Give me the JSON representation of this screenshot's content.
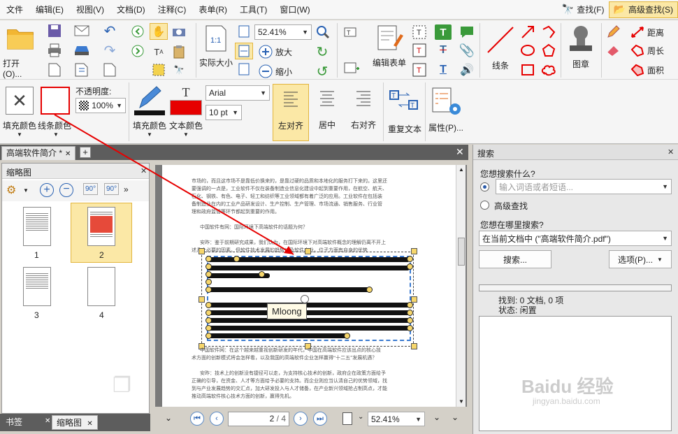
{
  "menu": [
    "文件",
    "编辑(E)",
    "视图(V)",
    "文档(D)",
    "注释(C)",
    "表单(R)",
    "工具(T)",
    "窗口(W)"
  ],
  "search_find": "查找(F)",
  "advanced_find": "高级查找(S)",
  "toolbar": {
    "open": "打开(O)...",
    "zoom_value": "52.41%",
    "actual_size": "实际大小",
    "zoom_in": "放大",
    "zoom_out": "缩小",
    "edit_form": "编辑表单",
    "line": "线条",
    "stamp": "图章",
    "distance": "距离",
    "perimeter": "周长",
    "area": "面积"
  },
  "props": {
    "fill_color": "填充颜色",
    "line_color": "线条颜色",
    "opacity_label": "不透明度:",
    "opacity_value": "100%",
    "fill_color2": "填充颜色",
    "text_color": "文本颜色",
    "font": "Arial",
    "font_size": "10 pt",
    "align_left": "左对齐",
    "align_center": "居中",
    "align_right": "右对齐",
    "repeat_text": "重复文本",
    "properties": "属性(P)..."
  },
  "doc_tab": "高端软件简介 *",
  "thumbnails": {
    "title": "缩略图",
    "pages": [
      "1",
      "2",
      "3",
      "4"
    ]
  },
  "document": {
    "para1": [
      "市场的，而且这市场不是靠低价换来的，是靠过硬的品质和本地化的服务打下来的。这里还",
      "要强调的一点是，工业软件不仅在装备制造业信息化建设中起到重要作用，在航空、航天、",
      "石化、钢铁、有色、电子、轻工和纺织等工业领域都有着广泛的应用。工业软件在包括装",
      "备制造业在内的工业产品研发设计、生产控制、生产管理、市场流通、销售服务、行业管",
      "理和政府监管等环节都起到重要的作用。"
    ],
    "question": "中国软件有网：国际环境下高端软件的话题为何？",
    "para2_first": "安昨：鉴于前期研究成果，我们认为，在国际环境下对高端软件概念的理解仍离不开上",
    "para2_second": "述几个必要的因素。但软件技术发展的趋势以及软件产业。位子方面有自身的优势",
    "para3": [
      "中国软件网：在这个越来越重视创新研发的年代，中国在高端软件应该出点的核心技",
      "术方面的创新模式将会怎样看，以及我国的高端软件企业怎样赢得“十二五”发展机遇？"
    ],
    "para4": [
      "安昨：技术上的创新没有捷径可以走，为支持核心技术的创新，政府企在政策方面给予",
      "正确的引导，在资金、人才等方面给予必要的支持。而企业则应当认清自己的优势领域，找",
      "到与产业发展趋势的交汇点，加大研发投入与人才储备，在产业新兴领域抢占制高点，才能",
      "推动高端软件核心技术方面的创新，赢得先机。"
    ],
    "annotation_label": "Mloong"
  },
  "nav": {
    "page_current": "2",
    "page_total": "/ 4",
    "zoom": "52.41%"
  },
  "search_panel": {
    "title": "搜索",
    "what_label": "您想搜索什么?",
    "placeholder": "输入词语或者短语...",
    "advanced": "高级查找",
    "where_label": "您想在哪里搜索?",
    "where_value": "在当前文档中 (\"高端软件简介.pdf\")",
    "search_btn": "搜索...",
    "options_btn": "选项(P)...",
    "found": "找到: 0 文档, 0 项",
    "status": "状态: 闲置",
    "watermark": "Baidu 经验",
    "watermark_url": "jingyan.baidu.com"
  },
  "bottom_tabs": [
    "书签",
    "缩略图"
  ],
  "colors": {
    "accent_red": "#e60000",
    "highlight": "#fbe8a6",
    "blue": "#2a62b3"
  }
}
